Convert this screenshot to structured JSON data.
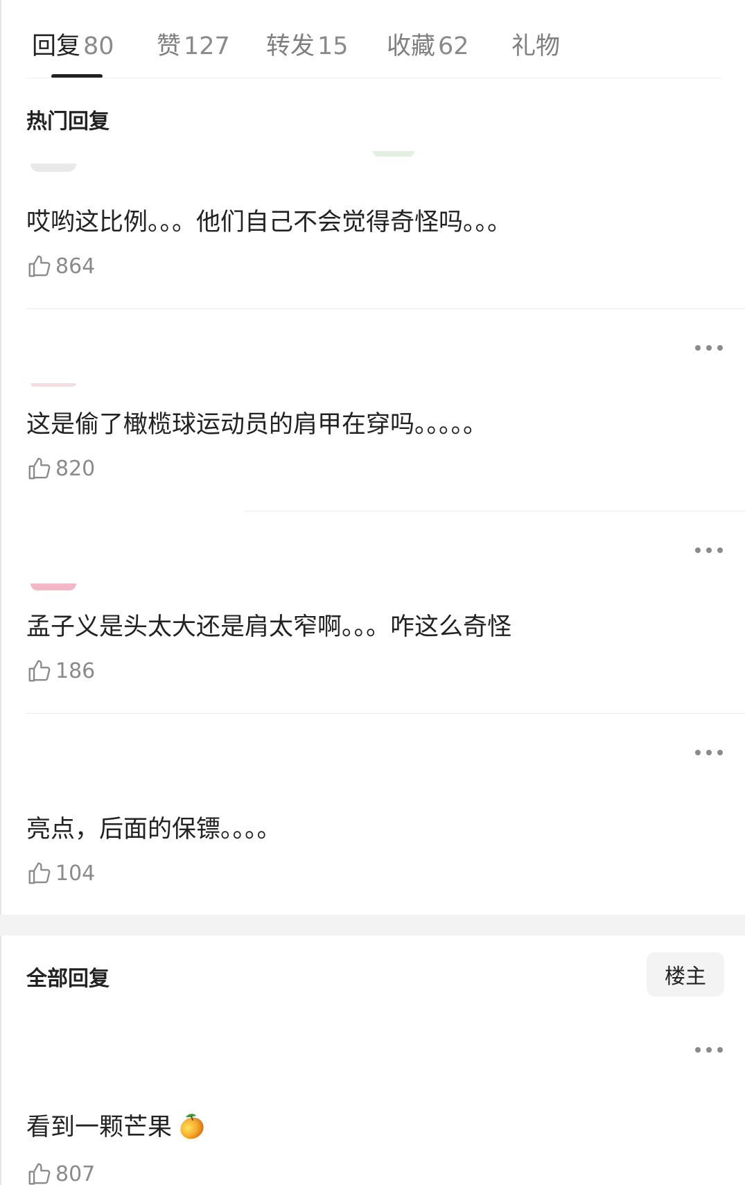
{
  "tabs": [
    {
      "label": "回复",
      "count": "80",
      "active": true
    },
    {
      "label": "赞",
      "count": "127",
      "active": false
    },
    {
      "label": "转发",
      "count": "15",
      "active": false
    },
    {
      "label": "收藏",
      "count": "62",
      "active": false
    },
    {
      "label": "礼物",
      "count": "",
      "active": false
    }
  ],
  "hot_section": {
    "title": "热门回复",
    "comments": [
      {
        "text": "哎哟这比例。。。他们自己不会觉得奇怪吗。。。",
        "likes": "864"
      },
      {
        "text": "这是偷了橄榄球运动员的肩甲在穿吗。。。。。",
        "likes": "820"
      },
      {
        "text": "孟子义是头太大还是肩太窄啊。。。咋这么奇怪",
        "likes": "186"
      },
      {
        "text": "亮点，后面的保镖。。。。",
        "likes": "104"
      }
    ]
  },
  "all_section": {
    "title": "全部回复",
    "owner_button": "楼主",
    "comments": [
      {
        "text": "看到一颗芒果",
        "emoji": "mango-emoji",
        "likes": "807"
      }
    ]
  },
  "icons": {
    "like": "thumbs-up-icon",
    "more": "more-dots-icon"
  },
  "colors": {
    "text_primary": "#222222",
    "text_secondary": "#8a8a8a",
    "band": "#f3f3f3"
  }
}
